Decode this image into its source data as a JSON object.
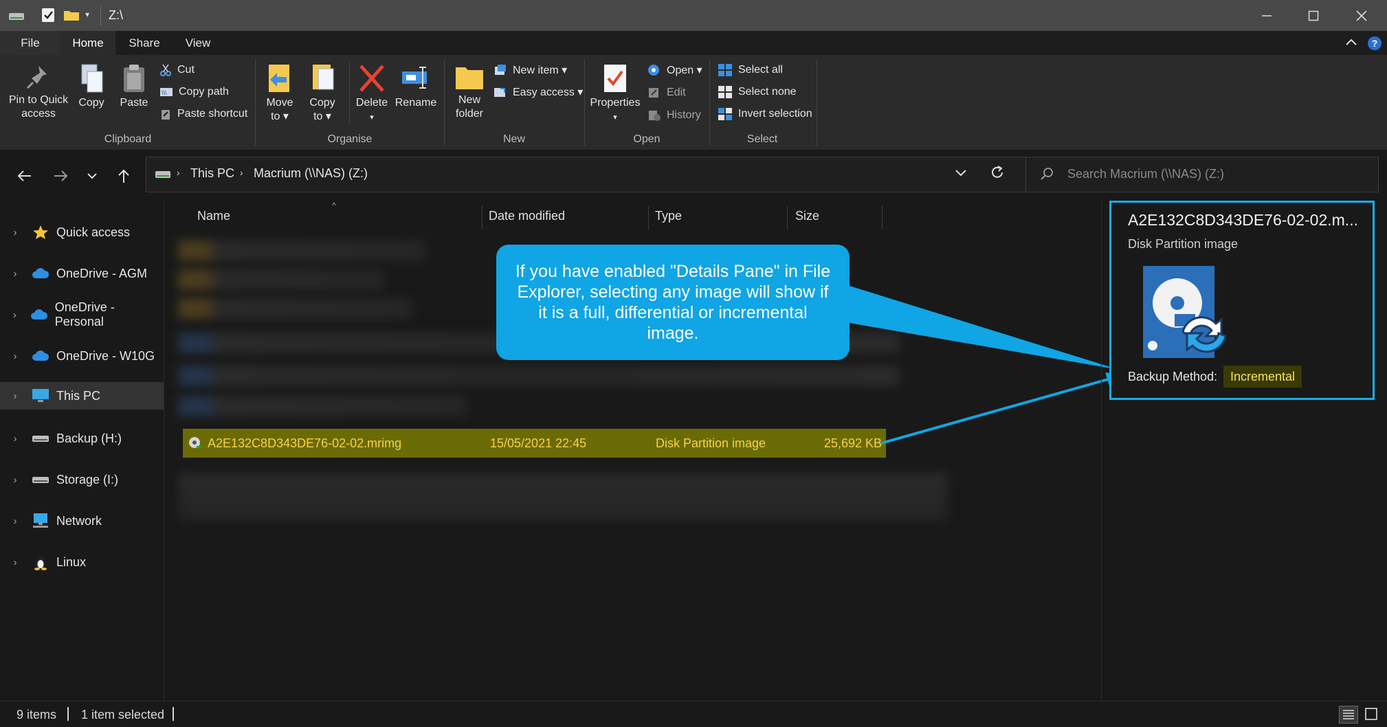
{
  "window": {
    "title": "Z:\\",
    "accent": "#15aee8",
    "highlight_row": "#6b6b06",
    "highlight_text": "#f5d24a"
  },
  "menu_tabs": [
    "File",
    "Home",
    "Share",
    "View"
  ],
  "ribbon": {
    "clipboard": {
      "pin_line1": "Pin to Quick",
      "pin_line2": "access",
      "copy": "Copy",
      "paste": "Paste",
      "cut": "Cut",
      "copy_path": "Copy path",
      "paste_shortcut": "Paste shortcut",
      "group_label": "Clipboard"
    },
    "organise": {
      "move_line1": "Move",
      "move_line2": "to ▾",
      "copyto_line1": "Copy",
      "copyto_line2": "to ▾",
      "delete": "Delete",
      "rename": "Rename",
      "group_label": "Organise"
    },
    "new": {
      "folder_line1": "New",
      "folder_line2": "folder",
      "new_item": "New item ▾",
      "easy_access": "Easy access ▾",
      "group_label": "New"
    },
    "open": {
      "properties": "Properties",
      "open": "Open ▾",
      "edit": "Edit",
      "history": "History",
      "group_label": "Open"
    },
    "select": {
      "select_all": "Select all",
      "select_none": "Select none",
      "invert_selection": "Invert selection",
      "group_label": "Select"
    }
  },
  "address": {
    "crumb1": "This PC",
    "crumb2": "Macrium (\\\\NAS) (Z:)",
    "search_placeholder": "Search Macrium (\\\\NAS) (Z:)"
  },
  "nav_items": [
    "Quick access",
    "OneDrive - AGM",
    "OneDrive - Personal",
    "OneDrive - W10G",
    "This PC",
    "Backup (H:)",
    "Storage (I:)",
    "Network",
    "Linux"
  ],
  "columns": {
    "name": "Name",
    "date": "Date modified",
    "type": "Type",
    "size": "Size"
  },
  "selected_file": {
    "name": "A2E132C8D343DE76-02-02.mrimg",
    "date": "15/05/2021 22:45",
    "type": "Disk Partition image",
    "size": "25,692 KB"
  },
  "callout": {
    "text": "If you have enabled \"Details Pane\" in File Explorer, selecting any image will show if it is a full, differential or incremental image."
  },
  "details": {
    "filename": "A2E132C8D343DE76-02-02.m...",
    "filetype": "Disk Partition image",
    "prop_label": "Backup Method:",
    "prop_value": "Incremental"
  },
  "status": {
    "items": "9 items",
    "selected": "1 item selected"
  }
}
